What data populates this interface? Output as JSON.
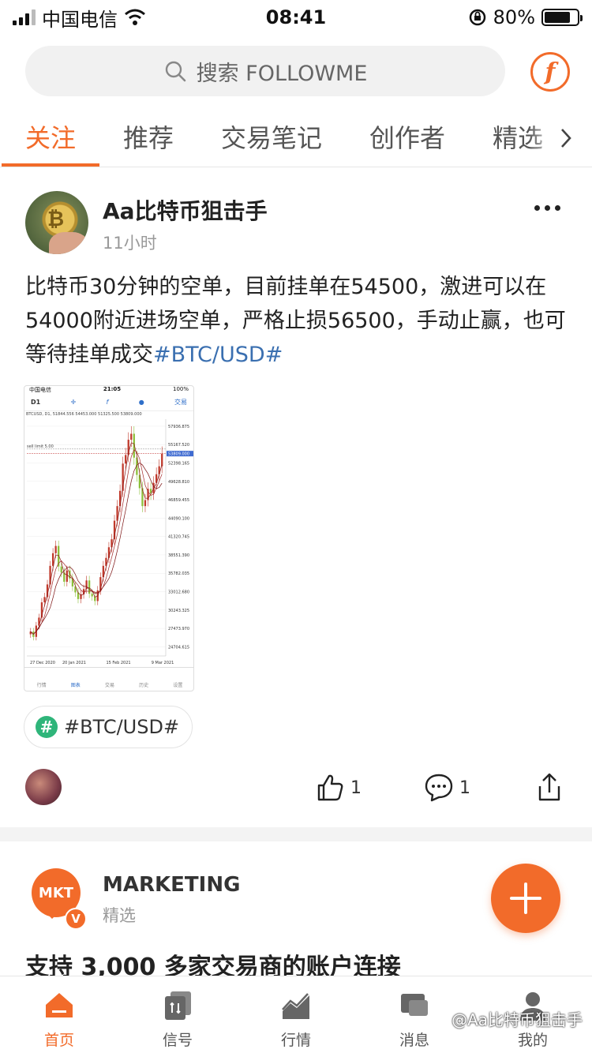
{
  "status_bar": {
    "carrier": "中国电信",
    "time": "08:41",
    "battery": "80%",
    "battery_level": 0.8
  },
  "search": {
    "placeholder": "搜索 FOLLOWME",
    "brand_icon": "followme-logo-icon",
    "brand_glyph": "f"
  },
  "tabs": [
    {
      "label": "关注",
      "active": true
    },
    {
      "label": "推荐",
      "active": false
    },
    {
      "label": "交易笔记",
      "active": false
    },
    {
      "label": "创作者",
      "active": false
    },
    {
      "label": "精选",
      "active": false
    }
  ],
  "post": {
    "author": "Aa比特币狙击手",
    "time": "11小时",
    "text": "比特币30分钟的空单，目前挂单在54500，激进可以在54000附近进场空单，严格止损56500，手动止赢，也可等待挂单成交",
    "hashtag_inline": "#BTC/USD#",
    "tag": "#BTC/USD#",
    "likes": "1",
    "comments": "1"
  },
  "screenshot": {
    "status_left": "中国电信",
    "status_time": "21:05",
    "status_right": "100%",
    "timeframe": "D1",
    "trade_label": "交易",
    "info": "BTCUSD, D1, 51844.556 54453.000 51325.500 53809.000",
    "sell_label": "sell limit 5.00",
    "nav": [
      "行情",
      "图表",
      "交易",
      "历史",
      "设置"
    ],
    "watermark": "Aa比特币狙击手"
  },
  "chart_data": {
    "type": "candlestick",
    "symbol": "BTCUSD",
    "timeframe": "D1",
    "ohlc_last": {
      "open": 51844.556,
      "high": 54453.0,
      "low": 51325.5,
      "close": 53809.0
    },
    "y_ticks": [
      "57936.875",
      "55167.520",
      "53809.000",
      "52398.165",
      "49628.810",
      "46859.455",
      "44090.100",
      "41320.745",
      "38551.390",
      "35782.035",
      "33012.680",
      "30243.325",
      "27473.970",
      "24704.615"
    ],
    "x_ticks": [
      "27 Dec 2020",
      "20 Jan 2021",
      "15 Feb 2021",
      "9 Mar 2021"
    ],
    "ylim": [
      23800,
      59000
    ],
    "current_price": 53809.0,
    "sell_limit_price": 54500,
    "closes": [
      27000,
      26200,
      27900,
      29100,
      31400,
      32200,
      34100,
      36900,
      38800,
      39900,
      36800,
      35900,
      34500,
      36200,
      35000,
      33800,
      32900,
      31900,
      32600,
      33400,
      34700,
      32700,
      32300,
      31600,
      33200,
      35200,
      36900,
      38100,
      39700,
      40900,
      43700,
      45900,
      48200,
      52300,
      53600,
      55900,
      56800,
      53200,
      50600,
      48600,
      45900,
      46800,
      48500,
      47800,
      49400,
      50700,
      51900,
      53809
    ]
  },
  "actions": {
    "like_icon": "thumbs-up-icon",
    "comment_icon": "comment-icon",
    "share_icon": "share-icon"
  },
  "post2": {
    "author": "MARKETING",
    "avatar_text": "MKT",
    "badge": "V",
    "subtitle": "精选",
    "title": "支持 3,000 多家交易商的账户连接"
  },
  "bottom_nav": [
    {
      "label": "首页",
      "active": true,
      "icon": "home-icon"
    },
    {
      "label": "信号",
      "active": false,
      "icon": "signal-icon"
    },
    {
      "label": "行情",
      "active": false,
      "icon": "market-icon"
    },
    {
      "label": "消息",
      "active": false,
      "icon": "message-icon"
    },
    {
      "label": "我的",
      "active": false,
      "icon": "profile-icon"
    }
  ],
  "watermark": "@Aa比特币狙击手",
  "colors": {
    "accent": "#f26b2a",
    "link": "#3a6fb0",
    "tag_green": "#2fb57a"
  }
}
